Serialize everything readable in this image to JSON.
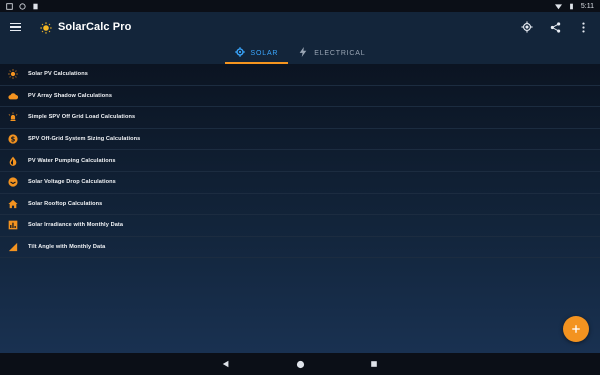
{
  "status_bar": {
    "time": "5:11",
    "left_icons": [
      "notification-a-icon",
      "notification-b-icon",
      "notification-c-icon"
    ],
    "right_icons": [
      "wifi-icon",
      "battery-icon"
    ]
  },
  "app_bar": {
    "title": "SolarCalc Pro",
    "actions": [
      "gps-icon",
      "share-icon",
      "more-vert-icon"
    ]
  },
  "tabs": [
    {
      "label": "SOLAR",
      "icon": "gear-icon",
      "active": true
    },
    {
      "label": "ELECTRICAL",
      "icon": "bolt-icon",
      "active": false
    }
  ],
  "items": [
    {
      "label": "Solar PV Calculations",
      "icon": "sun-icon"
    },
    {
      "label": "PV Array Shadow Calculations",
      "icon": "cloud-icon"
    },
    {
      "label": "Simple SPV Off Grid Load Calculations",
      "icon": "light-icon"
    },
    {
      "label": "SPV Off-Grid System Sizing Calculations",
      "icon": "dollar-icon"
    },
    {
      "label": "PV Water Pumping Calculations",
      "icon": "drop-icon"
    },
    {
      "label": "Solar Voltage Drop Calculations",
      "icon": "gauge-icon"
    },
    {
      "label": "Solar Rooftop Calculations",
      "icon": "home-icon"
    },
    {
      "label": "Solar Irradiance with Monthly Data",
      "icon": "chart-icon"
    },
    {
      "label": "Tilt Angle with Monthly Data",
      "icon": "angle-icon"
    }
  ],
  "fab": {
    "label": "+"
  },
  "nav_bar": [
    "back-icon",
    "home-icon",
    "recents-icon"
  ],
  "colors": {
    "accent_orange": "#f39320",
    "active_tab_blue": "#3aa7ff",
    "app_bar_bg": "#13253a",
    "content_bg_top": "#0b1422"
  }
}
